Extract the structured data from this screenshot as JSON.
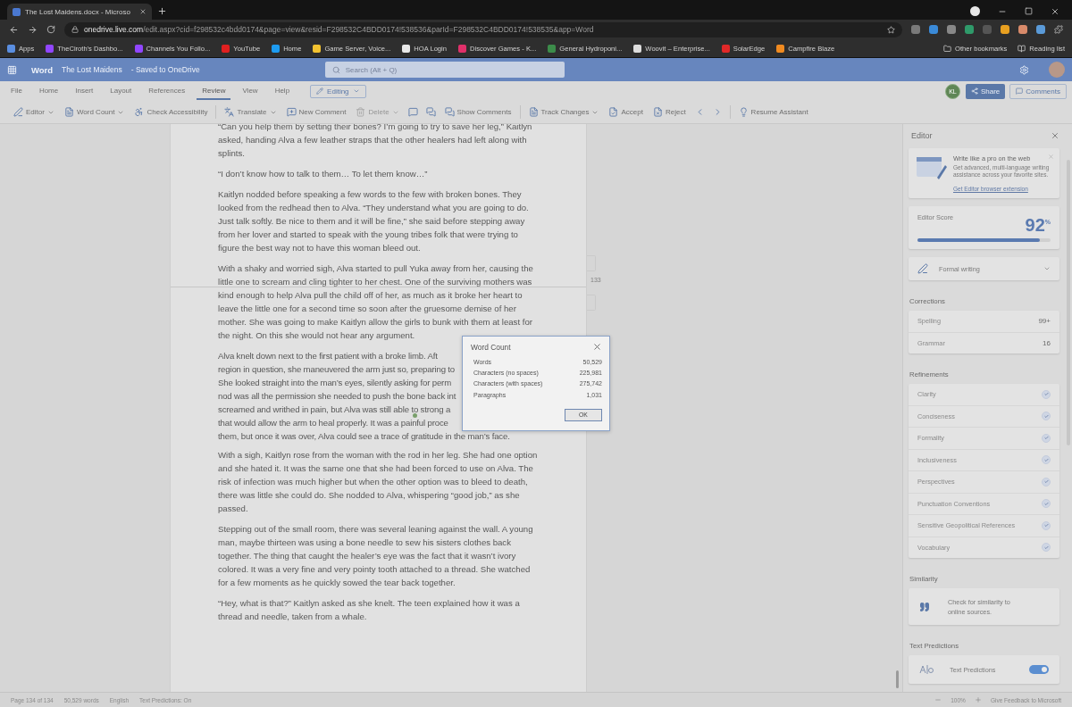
{
  "browser": {
    "tab": {
      "title": "The Lost Maidens.docx - Microso",
      "selected": true
    },
    "url": {
      "host": "onedrive.live.com",
      "path": "/edit.aspx?cid=f298532c4bdd0174&page=view&resid=F298532C4BDD0174!538536&parId=F298532C4BDD0174!538535&app=Word"
    },
    "bookmarks": [
      {
        "label": "Apps",
        "color": "#5a8ee0"
      },
      {
        "label": "TheCiroth's Dashbo...",
        "color": "#9146ff"
      },
      {
        "label": "Channels You Follo...",
        "color": "#9146ff"
      },
      {
        "label": "YouTube",
        "color": "#e02020"
      },
      {
        "label": "Home",
        "color": "#1d9bf0"
      },
      {
        "label": "Game Server, Voice...",
        "color": "#f2c230"
      },
      {
        "label": "HOA Login",
        "color": "#e8e8e8"
      },
      {
        "label": "Discover Games - K...",
        "color": "#e0306a"
      },
      {
        "label": "General Hydroponi...",
        "color": "#3c8c4a"
      },
      {
        "label": "Woovit – Enterprise...",
        "color": "#dddddd"
      },
      {
        "label": "SolarEdge",
        "color": "#e02828"
      },
      {
        "label": "Campfire Blaze",
        "color": "#f08a20"
      }
    ],
    "bookmarks_right": [
      {
        "label": "Other bookmarks"
      },
      {
        "label": "Reading list"
      }
    ]
  },
  "word_header": {
    "app": "Word",
    "doc_title": "The Lost Maidens",
    "save_status": "- Saved to OneDrive",
    "search_placeholder": "Search (Alt + Q)"
  },
  "menu_tabs": [
    {
      "label": "File",
      "selected": false
    },
    {
      "label": "Home",
      "selected": false
    },
    {
      "label": "Insert",
      "selected": false
    },
    {
      "label": "Layout",
      "selected": false
    },
    {
      "label": "References",
      "selected": false
    },
    {
      "label": "Review",
      "selected": true
    },
    {
      "label": "View",
      "selected": false
    },
    {
      "label": "Help",
      "selected": false
    }
  ],
  "mode_button": "Editing",
  "user_initials": "KL",
  "share_button": "Share",
  "comments_button": "Comments",
  "ribbon": [
    {
      "items": [
        {
          "kind": "button",
          "label": "Editor",
          "dropdown": true,
          "disabled": false
        },
        {
          "kind": "button",
          "label": "Word Count",
          "dropdown": true,
          "disabled": false
        },
        {
          "kind": "button",
          "label": "Check Accessibility",
          "dropdown": false,
          "disabled": false
        }
      ]
    },
    {
      "items": [
        {
          "kind": "button",
          "label": "Translate",
          "dropdown": true,
          "disabled": false
        },
        {
          "kind": "button",
          "label": "New Comment",
          "dropdown": false,
          "disabled": false
        },
        {
          "kind": "button",
          "label": "Delete",
          "dropdown": true,
          "disabled": true
        },
        {
          "kind": "icon"
        },
        {
          "kind": "icon"
        },
        {
          "kind": "button",
          "label": "Show Comments",
          "dropdown": false,
          "disabled": false
        }
      ]
    },
    {
      "items": [
        {
          "kind": "button",
          "label": "Track Changes",
          "dropdown": true,
          "disabled": false
        },
        {
          "kind": "button",
          "label": "Accept",
          "dropdown": false,
          "disabled": false
        },
        {
          "kind": "button",
          "label": "Reject",
          "dropdown": false,
          "disabled": false
        },
        {
          "kind": "icon"
        },
        {
          "kind": "icon"
        }
      ]
    },
    {
      "items": [
        {
          "kind": "button",
          "label": "Resume Assistant",
          "dropdown": false,
          "disabled": false
        }
      ]
    }
  ],
  "document": {
    "page_number": "133",
    "paragraphs": [
      {
        "kind": "text",
        "text": "“Can you help them by setting their bones? I’m going to try to save her leg,” Kaitlyn asked, handing Alva a few leather straps that the other healers had left along with splints."
      },
      {
        "kind": "text",
        "text": "“I don’t know how to talk to them… To let them know…”"
      },
      {
        "kind": "text",
        "text": "Kaitlyn nodded before speaking a few words to the few with broken bones. They looked from the redhead then to Alva. “They understand what you are going to do. Just talk softly. Be nice to them and it will be fine,” she said before stepping away from her lover and started to speak with the young tribes folk that were trying to figure the best way not to have this woman bleed out."
      },
      {
        "kind": "text",
        "text": "With a shaky and worried sigh, Alva started to pull Yuka away from her, causing the little one to scream and cling tighter to her chest. One of the surviving mothers was kind enough to help Alva pull the  child off of her, as much as it broke her heart to leave the little one for a second time so soon after the gruesome demise of her mother. She was going to make Kaitlyn allow the girls to bunk with them at least for the night. On this she would not hear any argument."
      },
      {
        "kind": "lines",
        "lines": [
          "Alva knelt down next to the first patient with a broke limb. Aft",
          "region in question, she maneuvered the arm just so, preparing to",
          "She looked straight into the man’s eyes, silently asking for perm",
          "nod was all the permission she needed to push the bone back int",
          "screamed and writhed in pain, but Alva was still able to strong a",
          "that would allow the arm to heal properly. It was a painful proce",
          "them, but once it was over, Alva could see a trace of gratitude in the man’s face."
        ]
      },
      {
        "kind": "text",
        "text": "With a sigh, Kaitlyn rose from the woman with the rod in her leg. She had one option and she hated it. It was the same one that she had been forced to use on Alva. The risk of infection was much higher but when the other option was to bleed to death, there was little she could do. She nodded to Alva, whispering “good job,” as she passed."
      },
      {
        "kind": "text",
        "text": "Stepping out of the small room, there was several leaning against the wall. A young man, maybe thirteen was using a bone needle to sew his sisters clothes back together. The thing that caught the healer’s eye was the fact that it wasn’t ivory colored. It was a very fine and very pointy tooth attached to a thread. She watched for a few moments as he quickly sowed the tear back together."
      },
      {
        "kind": "text",
        "text": "“Hey, what is that?” Kaitlyn asked as she knelt. The teen explained how it was a thread and needle, taken from a whale."
      }
    ]
  },
  "dialog": {
    "title": "Word Count",
    "rows": [
      {
        "label": "Words",
        "value": "50,529"
      },
      {
        "label": "Characters (no spaces)",
        "value": "225,981"
      },
      {
        "label": "Characters (with spaces)",
        "value": "275,742"
      },
      {
        "label": "Paragraphs",
        "value": "1,031"
      }
    ],
    "ok_button": "OK"
  },
  "editor_panel": {
    "title": "Editor",
    "promo": {
      "title": "Write like a pro on the web",
      "body": "Get advanced, multi-language writing assistance across your favorite sites.",
      "link": "Get Editor browser extension"
    },
    "score": {
      "label": "Editor Score",
      "value": "92",
      "unit": "%",
      "level": 0.92
    },
    "style": "Formal writing",
    "corrections_heading": "Corrections",
    "corrections": [
      {
        "label": "Spelling",
        "count": "99+"
      },
      {
        "label": "Grammar",
        "count": "16"
      }
    ],
    "refinements_heading": "Refinements",
    "refinements": [
      {
        "label": "Clarity",
        "checked": true
      },
      {
        "label": "Conciseness",
        "checked": true
      },
      {
        "label": "Formality",
        "checked": true
      },
      {
        "label": "Inclusiveness",
        "checked": true
      },
      {
        "label": "Perspectives",
        "checked": true
      },
      {
        "label": "Punctuation Conventions",
        "checked": true
      },
      {
        "label": "Sensitive Geopolitical References",
        "checked": true
      },
      {
        "label": "Vocabulary",
        "checked": true
      }
    ],
    "similarity_heading": "Similarity",
    "similarity_text": "Check for similarity to online sources.",
    "predictions_heading": "Text Predictions",
    "predictions": {
      "label": "Text Predictions",
      "on": true
    }
  },
  "status_bar": {
    "items": [
      "Page 134 of 134",
      "50,529 words",
      "English",
      "Text Predictions: On"
    ],
    "zoom": "100%",
    "feedback": "Give Feedback to Microsoft"
  }
}
